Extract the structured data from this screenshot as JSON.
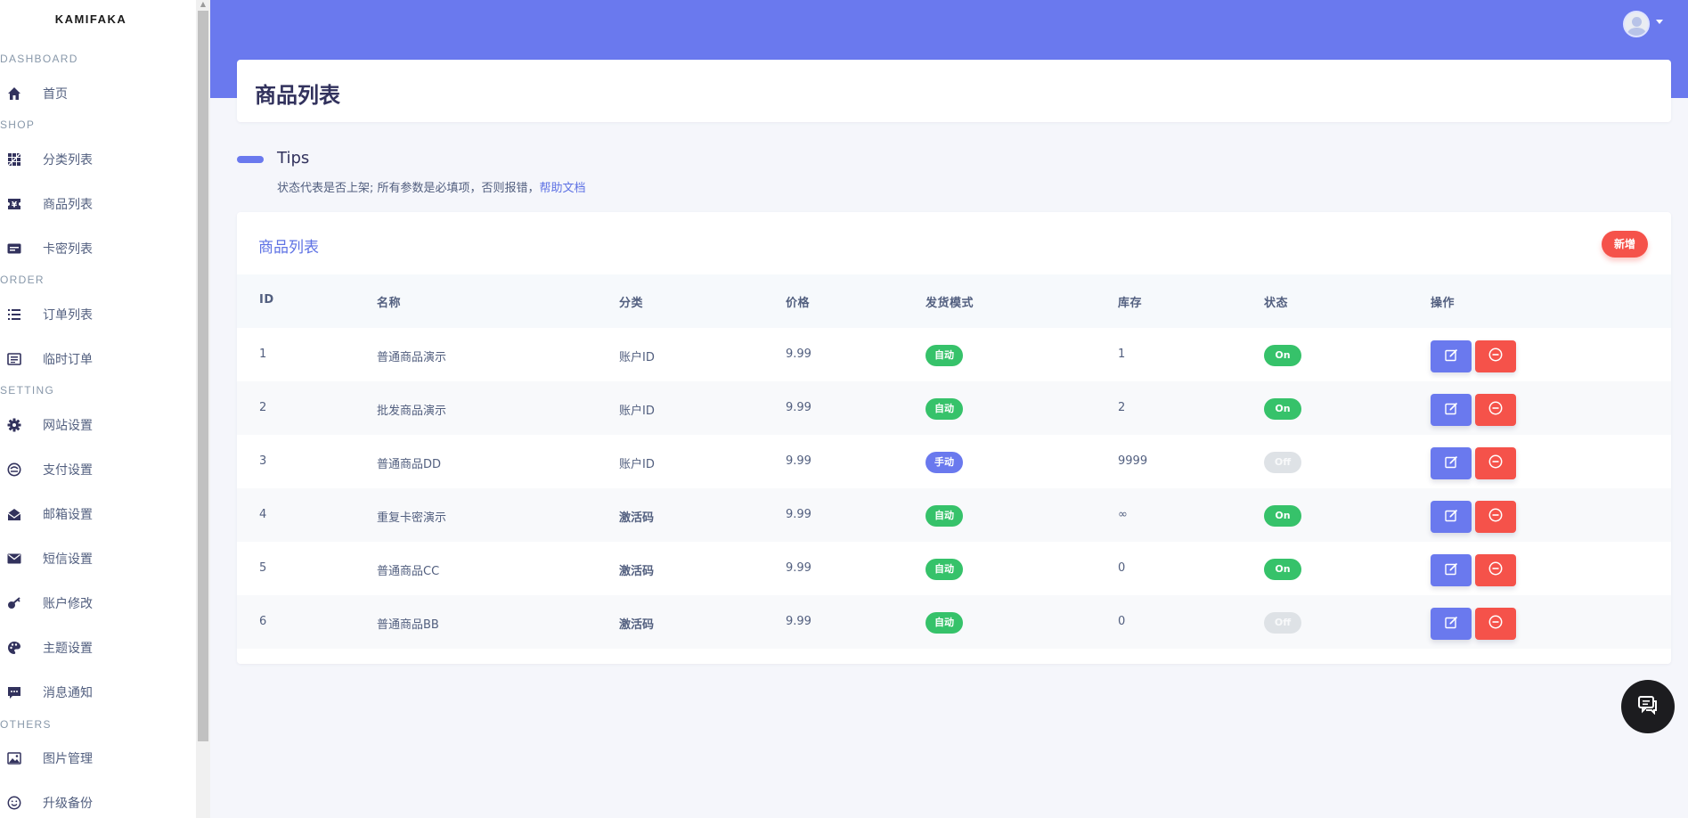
{
  "sidebar": {
    "brand": "KAMIFAKA",
    "sections": {
      "dashboard": "DASHBOARD",
      "shop": "SHOP",
      "order": "ORDER",
      "setting": "SETTING",
      "others": "OTHERS"
    },
    "items": {
      "home": "首页",
      "category": "分类列表",
      "goods": "商品列表",
      "cards": "卡密列表",
      "orders": "订单列表",
      "temp_orders": "临时订单",
      "site": "网站设置",
      "payment": "支付设置",
      "mail": "邮箱设置",
      "sms": "短信设置",
      "account": "账户修改",
      "theme": "主题设置",
      "notice": "消息通知",
      "images": "图片管理",
      "upgrade": "升级备份"
    }
  },
  "header": {
    "page_title": "商品列表"
  },
  "tips": {
    "title": "Tips",
    "text": "状态代表是否上架; 所有参数是必填项，否则报错，",
    "link": "帮助文档"
  },
  "table": {
    "title": "商品列表",
    "new_label": "新增",
    "headers": {
      "id": "ID",
      "name": "名称",
      "category": "分类",
      "price": "价格",
      "mode": "发货模式",
      "stock": "库存",
      "status": "状态",
      "actions": "操作"
    },
    "rows": [
      {
        "id": "1",
        "name": "普通商品演示",
        "category": "账户ID",
        "price": "9.99",
        "mode": "自动",
        "stock": "1",
        "status": "On"
      },
      {
        "id": "2",
        "name": "批发商品演示",
        "category": "账户ID",
        "price": "9.99",
        "mode": "自动",
        "stock": "2",
        "status": "On"
      },
      {
        "id": "3",
        "name": "普通商品DD",
        "category": "账户ID",
        "price": "9.99",
        "mode": "手动",
        "stock": "9999",
        "status": "Off"
      },
      {
        "id": "4",
        "name": "重复卡密演示",
        "category": "激活码",
        "price": "9.99",
        "mode": "自动",
        "stock": "∞",
        "status": "On"
      },
      {
        "id": "5",
        "name": "普通商品CC",
        "category": "激活码",
        "price": "9.99",
        "mode": "自动",
        "stock": "0",
        "status": "On"
      },
      {
        "id": "6",
        "name": "普通商品BB",
        "category": "激活码",
        "price": "9.99",
        "mode": "自动",
        "stock": "0",
        "status": "Off"
      }
    ]
  },
  "colors": {
    "primary": "#6a79ee",
    "success": "#36c26a",
    "danger": "#f5524a",
    "link": "#5e72e4"
  },
  "icons": {
    "home": "home-icon",
    "category": "grid-icon",
    "goods": "ticket-icon",
    "cards": "card-icon",
    "orders": "list-icon",
    "temp_orders": "receipt-icon",
    "site": "gear-icon",
    "payment": "wallet-icon",
    "mail": "envelope-open-icon",
    "sms": "envelope-icon",
    "account": "key-icon",
    "theme": "palette-icon",
    "notice": "chat-icon",
    "images": "image-icon",
    "upgrade": "smile-icon",
    "edit": "edit-icon",
    "delete": "minus-circle-icon",
    "chat": "chat-bubbles-icon"
  }
}
